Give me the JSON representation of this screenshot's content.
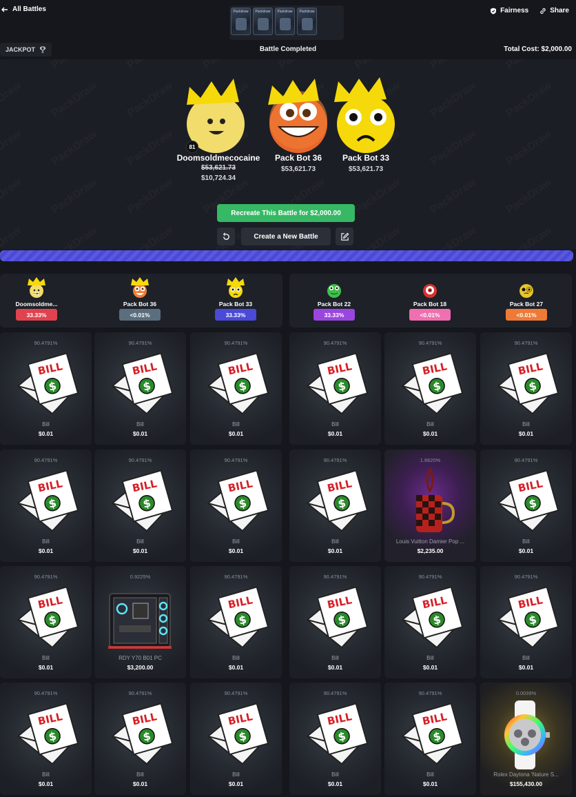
{
  "header": {
    "back_label": "All Battles",
    "pack_thumb_label": "Packdraw",
    "fairness_label": "Fairness",
    "share_label": "Share",
    "mode_label": "JACKPOT",
    "status": "Battle Completed",
    "total_cost": "Total Cost: $2,000.00"
  },
  "watermark_text": "PackDraw",
  "winners": [
    {
      "name": "Doomsoldmecocaine",
      "old_value": "$53,621.73",
      "new_value": "$10,724.34",
      "level": "81",
      "avatar": "yellow-smiley"
    },
    {
      "name": "Pack Bot 36",
      "old_value": "",
      "new_value": "$53,621.73",
      "level": "",
      "avatar": "orange-googly-eyes"
    },
    {
      "name": "Pack Bot 33",
      "old_value": "",
      "new_value": "$53,621.73",
      "level": "",
      "avatar": "yellow-sad"
    }
  ],
  "actions": {
    "recreate_label": "Recreate This Battle for $2,000.00",
    "new_battle_label": "Create a New Battle"
  },
  "progress_percent": 100,
  "players": [
    {
      "name": "Doomsoldme...",
      "pct": "33.33%",
      "color": "#e0424f",
      "avatar": "yellow-smiley",
      "crown": true,
      "level": "81"
    },
    {
      "name": "Pack Bot 36",
      "pct": "<0.01%",
      "color": "#5b6e7d",
      "avatar": "orange-googly-eyes",
      "crown": true,
      "level": ""
    },
    {
      "name": "Pack Bot 33",
      "pct": "33.33%",
      "color": "#4a49d8",
      "avatar": "yellow-sad",
      "crown": true,
      "level": ""
    },
    {
      "name": "Pack Bot 22",
      "pct": "33.33%",
      "color": "#9b45e0",
      "avatar": "green-frog",
      "crown": false,
      "level": ""
    },
    {
      "name": "Pack Bot 18",
      "pct": "<0.01%",
      "color": "#ef6fb0",
      "avatar": "red-eye",
      "crown": false,
      "level": ""
    },
    {
      "name": "Pack Bot 27",
      "pct": "<0.01%",
      "color": "#ef7a36",
      "avatar": "yellow-monocle",
      "crown": false,
      "level": ""
    }
  ],
  "item_rows": [
    [
      {
        "odds": "90.4791%",
        "name": "Bill",
        "price": "$0.01",
        "kind": "bill"
      },
      {
        "odds": "90.4791%",
        "name": "Bill",
        "price": "$0.01",
        "kind": "bill"
      },
      {
        "odds": "90.4791%",
        "name": "Bill",
        "price": "$0.01",
        "kind": "bill"
      },
      {
        "odds": "90.4791%",
        "name": "Bill",
        "price": "$0.01",
        "kind": "bill"
      },
      {
        "odds": "90.4791%",
        "name": "Bill",
        "price": "$0.01",
        "kind": "bill"
      },
      {
        "odds": "90.4791%",
        "name": "Bill",
        "price": "$0.01",
        "kind": "bill"
      }
    ],
    [
      {
        "odds": "90.4791%",
        "name": "Bill",
        "price": "$0.01",
        "kind": "bill"
      },
      {
        "odds": "90.4791%",
        "name": "Bill",
        "price": "$0.01",
        "kind": "bill"
      },
      {
        "odds": "90.4791%",
        "name": "Bill",
        "price": "$0.01",
        "kind": "bill"
      },
      {
        "odds": "90.4791%",
        "name": "Bill",
        "price": "$0.01",
        "kind": "bill"
      },
      {
        "odds": "1.6620%",
        "name": "Louis Vuitton Damier Pop ...",
        "price": "$2,235.00",
        "kind": "bag"
      },
      {
        "odds": "90.4791%",
        "name": "Bill",
        "price": "$0.01",
        "kind": "bill"
      }
    ],
    [
      {
        "odds": "90.4791%",
        "name": "Bill",
        "price": "$0.01",
        "kind": "bill"
      },
      {
        "odds": "0.9225%",
        "name": "RDY Y70 B01 PC",
        "price": "$3,200.00",
        "kind": "pc"
      },
      {
        "odds": "90.4791%",
        "name": "Bill",
        "price": "$0.01",
        "kind": "bill"
      },
      {
        "odds": "90.4791%",
        "name": "Bill",
        "price": "$0.01",
        "kind": "bill"
      },
      {
        "odds": "90.4791%",
        "name": "Bill",
        "price": "$0.01",
        "kind": "bill"
      },
      {
        "odds": "90.4791%",
        "name": "Bill",
        "price": "$0.01",
        "kind": "bill"
      }
    ],
    [
      {
        "odds": "90.4791%",
        "name": "Bill",
        "price": "$0.01",
        "kind": "bill"
      },
      {
        "odds": "90.4791%",
        "name": "Bill",
        "price": "$0.01",
        "kind": "bill"
      },
      {
        "odds": "90.4791%",
        "name": "Bill",
        "price": "$0.01",
        "kind": "bill"
      },
      {
        "odds": "90.4791%",
        "name": "Bill",
        "price": "$0.01",
        "kind": "bill"
      },
      {
        "odds": "90.4791%",
        "name": "Bill",
        "price": "$0.01",
        "kind": "bill"
      },
      {
        "odds": "0.0039%",
        "name": "Rolex Daytona 'Nature S...",
        "price": "$155,430.00",
        "kind": "watch"
      }
    ]
  ],
  "bill_text": "BILL",
  "colors": {
    "accent_green": "#36b864",
    "progress": "#4a49d8",
    "crown": "#f5d90a"
  }
}
